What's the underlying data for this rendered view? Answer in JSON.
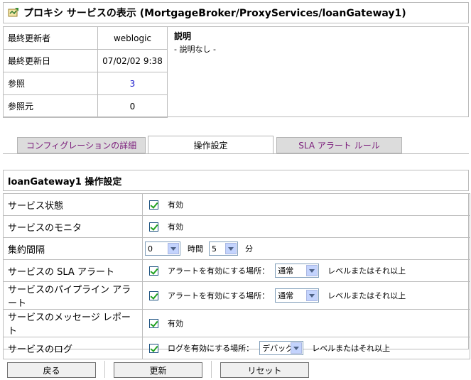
{
  "title": "プロキシ サービスの表示 (MortgageBroker/ProxyServices/loanGateway1)",
  "info": {
    "rows": [
      {
        "label": "最終更新者",
        "value": "weblogic"
      },
      {
        "label": "最終更新日",
        "value": "07/02/02 9:38"
      },
      {
        "label": "参照",
        "value": "3"
      },
      {
        "label": "参照元",
        "value": "0"
      }
    ],
    "description_heading": "説明",
    "description_text": "- 説明なし -"
  },
  "tabs": [
    {
      "label": "コンフィグレーションの詳細",
      "active": false
    },
    {
      "label": "操作設定",
      "active": true
    },
    {
      "label": "SLA アラート ルール",
      "active": false
    }
  ],
  "section_title": "loanGateway1 操作設定",
  "settings": {
    "service_state": {
      "label": "サービス状態",
      "checked": true,
      "text": "有効"
    },
    "service_monitor": {
      "label": "サービスのモニタ",
      "checked": true,
      "text": "有効"
    },
    "aggregation": {
      "label": "集約間隔",
      "hours_value": "0",
      "hours_unit": "時間",
      "minutes_value": "5",
      "minutes_unit": "分"
    },
    "sla_alert": {
      "label": "サービスの SLA アラート",
      "checked": true,
      "prefix": "アラートを有効にする場所：",
      "level": "通常",
      "suffix": "レベルまたはそれ以上"
    },
    "pipeline_alert": {
      "label": "サービスのパイプライン アラート",
      "checked": true,
      "prefix": "アラートを有効にする場所：",
      "level": "通常",
      "suffix": "レベルまたはそれ以上"
    },
    "message_report": {
      "label": "サービスのメッセージ レポート",
      "checked": true,
      "text": "有効"
    },
    "logging": {
      "label": "サービスのログ",
      "checked": true,
      "prefix": "ログを有効にする場所：",
      "level": "デバッグ",
      "suffix": "レベルまたはそれ以上"
    }
  },
  "buttons": {
    "back": "戻る",
    "update": "更新",
    "reset": "リセット"
  },
  "colors": {
    "border": "#bcbcbc",
    "tab_inactive_bg": "#dcdcdc",
    "tab_inactive_text": "#7a1a7a",
    "link": "#1a1acc",
    "check": "#21a121"
  }
}
